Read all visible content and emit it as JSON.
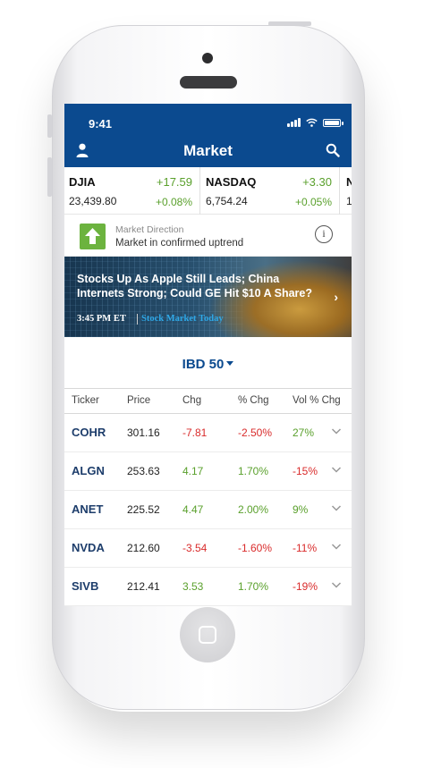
{
  "status_bar": {
    "time": "9:41"
  },
  "header": {
    "title": "Market"
  },
  "tickers": [
    {
      "name": "DJIA",
      "change": "+17.59",
      "value": "23,439.80",
      "pct": "+0.08%"
    },
    {
      "name": "NASDAQ",
      "change": "+3.30",
      "value": "6,754.24",
      "pct": "+0.05%"
    },
    {
      "name": "N",
      "value": "1"
    }
  ],
  "market_direction": {
    "label": "Market Direction",
    "value": "Market in confirmed uptrend"
  },
  "news": {
    "headline": "Stocks Up As Apple Still Leads; China Internets Strong; Could GE Hit $10 A Share?",
    "time": "3:45 PM ET",
    "category": "Stock Market Today"
  },
  "list_selector": {
    "label": "IBD 50"
  },
  "table": {
    "headers": [
      "Ticker",
      "Price",
      "Chg",
      "% Chg",
      "Vol % Chg"
    ],
    "rows": [
      {
        "ticker": "COHR",
        "price": "301.16",
        "chg": "-7.81",
        "pct": "-2.50%",
        "vol": "27%"
      },
      {
        "ticker": "ALGN",
        "price": "253.63",
        "chg": "4.17",
        "pct": "1.70%",
        "vol": "-15%"
      },
      {
        "ticker": "ANET",
        "price": "225.52",
        "chg": "4.47",
        "pct": "2.00%",
        "vol": "9%"
      },
      {
        "ticker": "NVDA",
        "price": "212.60",
        "chg": "-3.54",
        "pct": "-1.60%",
        "vol": "-11%"
      },
      {
        "ticker": "SIVB",
        "price": "212.41",
        "chg": "3.53",
        "pct": "1.70%",
        "vol": "-19%"
      }
    ]
  },
  "colors": {
    "brand_blue": "#0b4a8f",
    "positive": "#5aa02c",
    "negative": "#d92b2b",
    "uptrend_badge": "#6cb33f",
    "news_category": "#2ea7e6"
  }
}
